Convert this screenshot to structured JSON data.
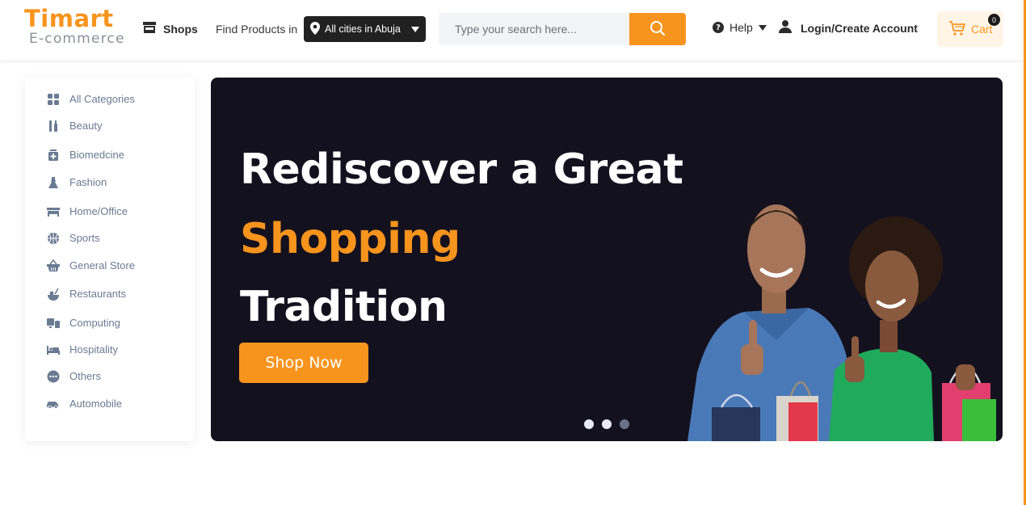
{
  "header": {
    "logo_main": "Timart",
    "logo_sub": "E-commerce",
    "shops_label": "Shops",
    "find_label": "Find Products in",
    "city_label": "All cities in Abuja",
    "search_placeholder": "Type your search here...",
    "help_label": "Help",
    "login_label": "Login/Create Account",
    "cart_label": "Cart",
    "cart_count": "0"
  },
  "sidebar": {
    "items": [
      {
        "label": "All Categories",
        "icon": "grid-icon"
      },
      {
        "label": "Beauty",
        "icon": "beauty-icon"
      },
      {
        "label": "Biomedcine",
        "icon": "medicine-icon"
      },
      {
        "label": "Fashion",
        "icon": "dress-icon"
      },
      {
        "label": "Home/Office",
        "icon": "furniture-icon"
      },
      {
        "label": "Sports",
        "icon": "basketball-icon"
      },
      {
        "label": "General Store",
        "icon": "basket-icon"
      },
      {
        "label": "Restaurants",
        "icon": "food-icon"
      },
      {
        "label": "Computing",
        "icon": "computer-icon"
      },
      {
        "label": "Hospitality",
        "icon": "bed-icon"
      },
      {
        "label": "Others",
        "icon": "more-icon"
      },
      {
        "label": "Automobile",
        "icon": "car-icon"
      }
    ]
  },
  "hero": {
    "line1": "Rediscover a Great",
    "line2": "Shopping",
    "line3": "Tradition",
    "cta": "Shop Now",
    "slides": 3,
    "active_slide": 1
  },
  "colors": {
    "accent": "#f7941d",
    "hero_bg": "#14111f",
    "sidebar_text": "#6a7a93"
  }
}
